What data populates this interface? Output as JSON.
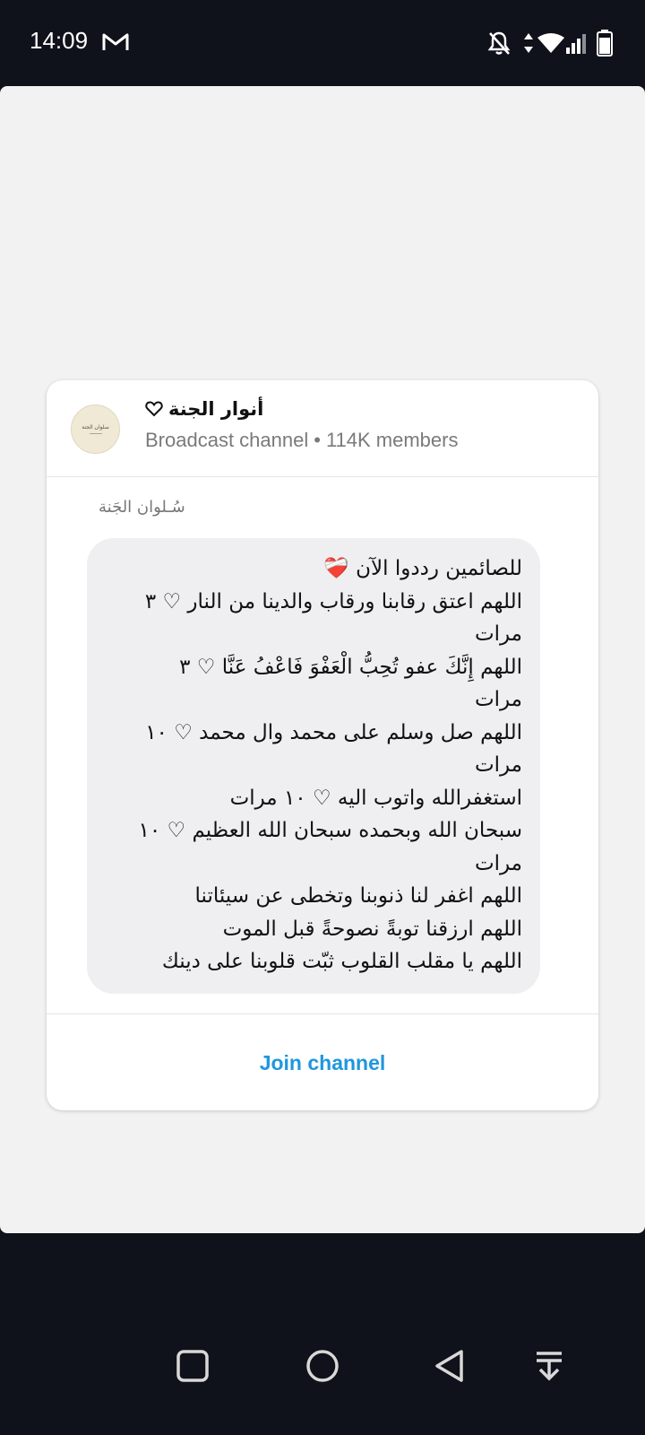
{
  "status_bar": {
    "time": "14:09",
    "icons": [
      "gmail-icon",
      "bell-off-icon",
      "data-arrows-icon",
      "wifi-icon",
      "signal-icon",
      "battery-icon"
    ]
  },
  "channel": {
    "name": "أنوار الجنة",
    "avatar_text": "سلوان الجنة",
    "type": "Broadcast channel",
    "separator": "•",
    "members": "114K members"
  },
  "message": {
    "sender": "سُـلوان الجَنة",
    "lines": [
      "للصائمين رددوا الآن ❤️‍🩹",
      "اللهم اعتق رقابنا ورقاب والدينا من النار ♡ ٣",
      "مرات",
      "اللهم إِنَّكَ عفو تُحِبُّ الْعَفْوَ فَاعْفُ عَنَّا ♡ ٣",
      "مرات",
      "اللهم صل وسلم على محمد وال محمد ♡ ١٠",
      "مرات",
      "استغفرالله واتوب اليه ♡ ١٠ مرات",
      "سبحان الله وبحمده سبحان الله العظيم ♡ ١٠",
      "مرات",
      "اللهم اغفر لنا ذنوبنا وتخطى عن سيئاتنا",
      "اللهم ارزقنا توبةً نصوحةً قبل الموت",
      "اللهم يا مقلب القلوب ثبّت قلوبنا على دينك"
    ]
  },
  "actions": {
    "join_label": "Join channel"
  },
  "colors": {
    "accent": "#1f96e0",
    "sheet_bg": "#f2f2f2",
    "bubble_bg": "#efeff2",
    "system_bg": "#0f121a"
  },
  "nav_bar": {
    "icons": [
      "recents-square-icon",
      "home-circle-icon",
      "back-triangle-icon",
      "notification-pull-icon"
    ]
  }
}
